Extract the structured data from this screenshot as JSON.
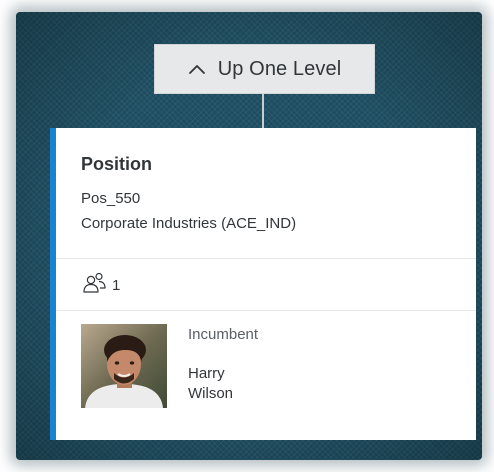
{
  "navigation": {
    "up_label": "Up One Level",
    "up_icon": "chevron-up-icon"
  },
  "card": {
    "title": "Position",
    "position_id": "Pos_550",
    "organization": "Corporate Industries (ACE_IND)",
    "people_icon": "people-group-icon",
    "people_count": "1",
    "incumbent_label": "Incumbent",
    "first_name": "Harry",
    "last_name": "Wilson",
    "accent_color": "#1b82d1"
  },
  "colors": {
    "canvas_background": "#1d4d60",
    "button_background": "#e6e8e9",
    "text": "#32363a"
  }
}
